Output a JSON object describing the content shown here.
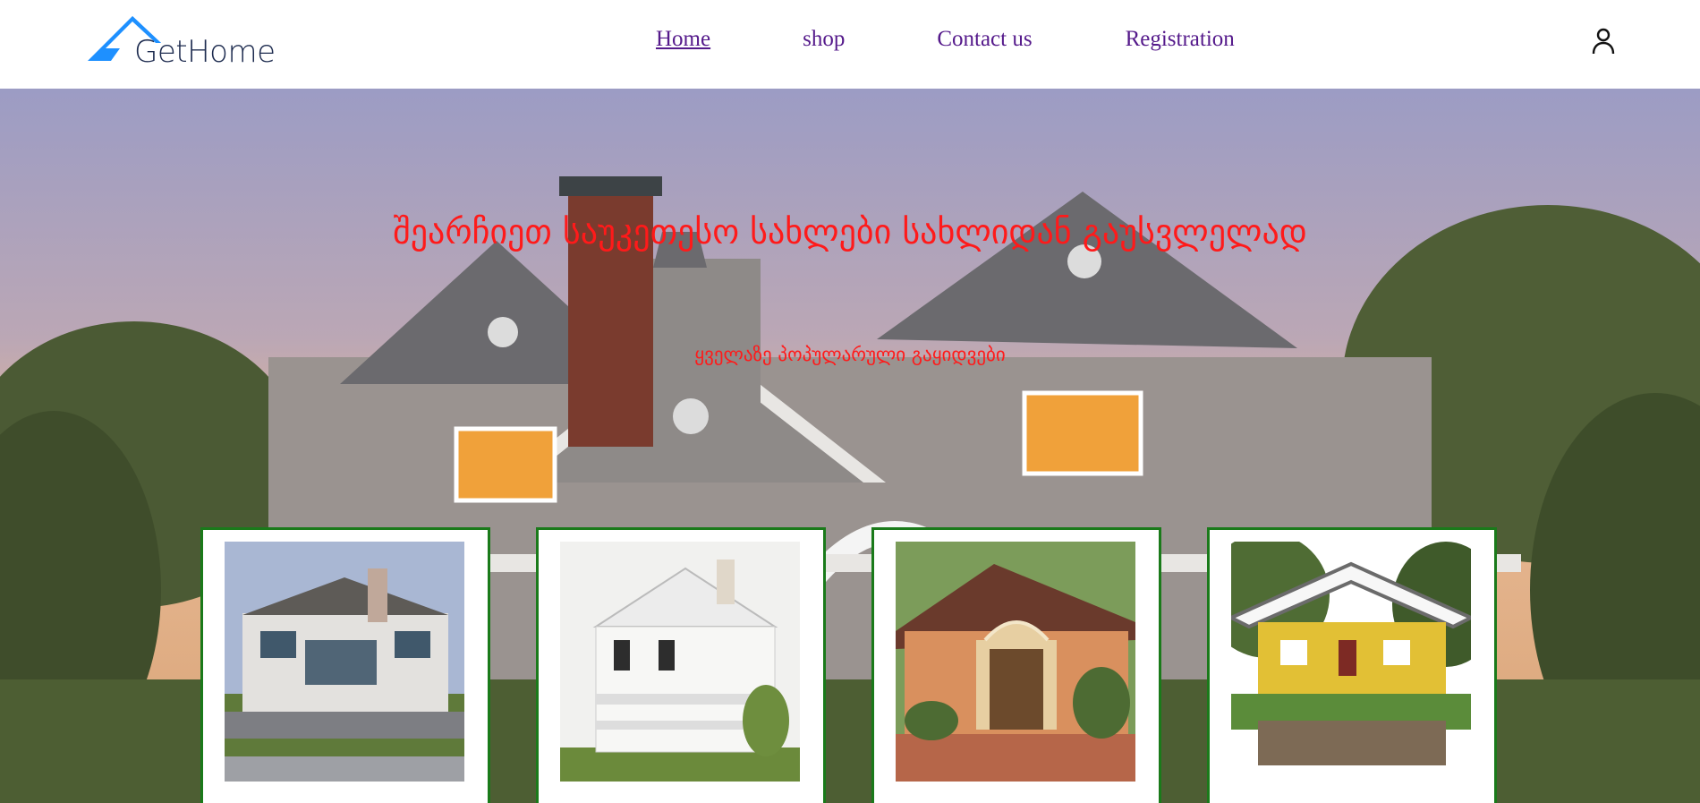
{
  "brand": {
    "name": "GetHome",
    "accent": "#1e90ff"
  },
  "nav": {
    "items": [
      {
        "label": "Home",
        "active": true
      },
      {
        "label": "shop",
        "active": false
      },
      {
        "label": "Contact us",
        "active": false
      },
      {
        "label": "Registration",
        "active": false
      }
    ],
    "link_color": "#551a8b"
  },
  "header": {
    "user_icon": "user-icon"
  },
  "hero": {
    "title": "შეარჩიეთ საუკეთესო სახლები სახლიდან გაუსვლელად",
    "subtitle": "ყველაზე პოპულარული გაყიდვები",
    "text_color": "#ff1a1a"
  },
  "cards": [
    {
      "image": "house-photo-1",
      "border_color": "#1a7a1a",
      "caption": ""
    },
    {
      "image": "house-photo-2",
      "border_color": "#1a7a1a",
      "caption": ""
    },
    {
      "image": "house-photo-3",
      "border_color": "#1a7a1a",
      "caption": ""
    },
    {
      "image": "house-photo-4",
      "border_color": "#1a7a1a",
      "caption": ""
    }
  ]
}
